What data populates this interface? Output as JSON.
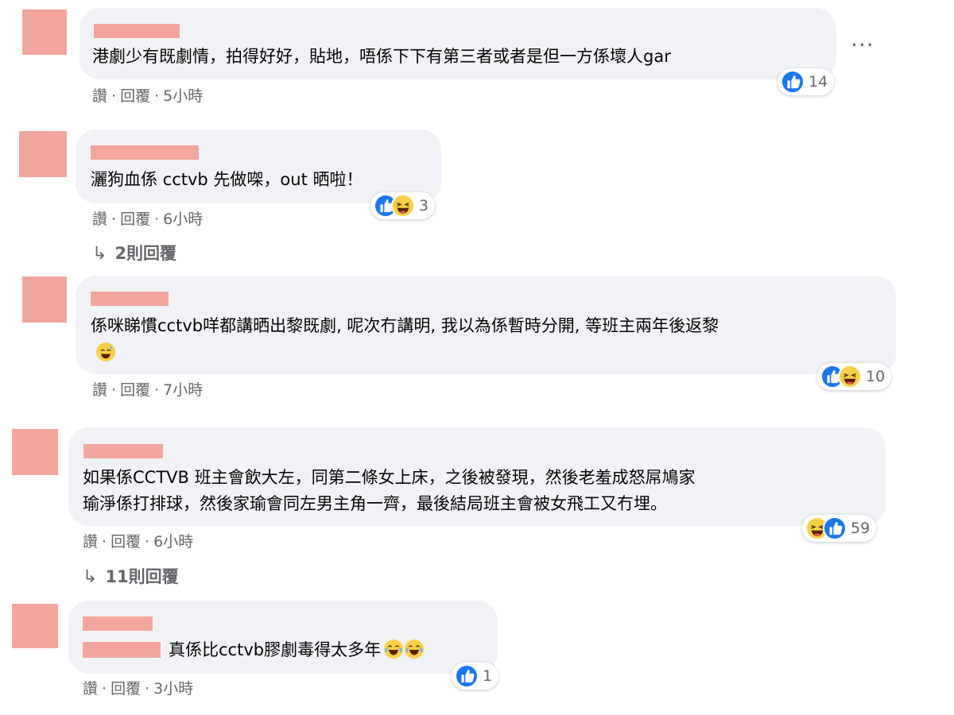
{
  "labels": {
    "like": "讚",
    "reply": "回覆"
  },
  "comments": [
    {
      "text": "港劇少有既劇情，拍得好好，貼地，唔係下下有第三者或者是但一方係壞人gar",
      "time": "5小時",
      "reactions": [
        "like-icon"
      ],
      "reaction_count": "14"
    },
    {
      "text": "灑狗血係 cctvb 先做㗎，out 晒啦！",
      "time": "6小時",
      "reactions": [
        "like-icon",
        "haha-icon"
      ],
      "reaction_count": "3",
      "replies": "2則回覆"
    },
    {
      "text": "係咪睇慣cctvb咩都講晒出黎既劇, 呢次冇講明, 我以為係暫時分開, 等班主兩年後返黎",
      "trailing_emoji": "sweat-smile-icon",
      "time": "7小時",
      "reactions": [
        "like-icon",
        "haha-icon"
      ],
      "reaction_count": "10"
    },
    {
      "text_line1": "如果係CCTVB 班主會飲大左，同第二條女上床，之後被發現，然後老羞成怒屌鳩家",
      "text_line2": "瑜淨係打排球，然後家瑜會同左男主角一齊，最後結局班主會被女飛工又冇埋。",
      "time": "6小時",
      "reactions": [
        "haha-icon",
        "like-icon"
      ],
      "reaction_count": "59",
      "replies": "11則回覆"
    },
    {
      "text": "真係比cctvb膠劇毒得太多年",
      "trailing_emoji": "laughing-crying-icon",
      "time": "3小時",
      "reactions": [
        "like-icon"
      ],
      "reaction_count": "1"
    }
  ],
  "more_options": "···",
  "colors": {
    "bubble": "#f0f2f5",
    "redaction": "#f2a59a",
    "meta": "#65676b",
    "like": "#1877f2",
    "haha": "#f7d046"
  }
}
